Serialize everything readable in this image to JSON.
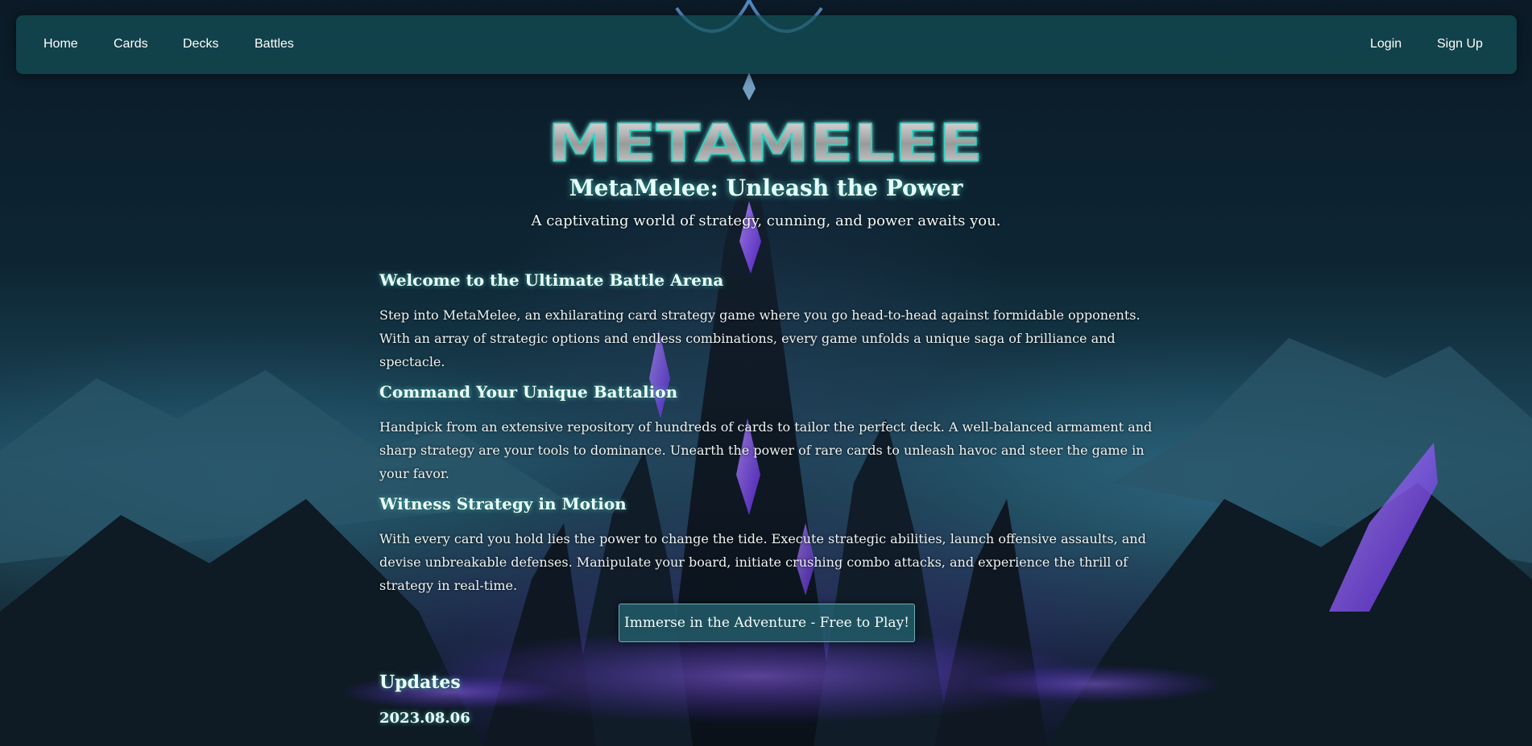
{
  "nav": {
    "left": [
      "Home",
      "Cards",
      "Decks",
      "Battles"
    ],
    "right": [
      "Login",
      "Sign Up"
    ]
  },
  "brand": {
    "logo_text": "METAMELEE",
    "title": "MetaMelee: Unleash the Power",
    "subtitle": "A captivating world of strategy, cunning, and power awaits you."
  },
  "sections": [
    {
      "title": "Welcome to the Ultimate Battle Arena",
      "text": "Step into MetaMelee, an exhilarating card strategy game where you go head-to-head against formidable opponents. With an array of strategic options and endless combinations, every game unfolds a unique saga of brilliance and spectacle."
    },
    {
      "title": "Command Your Unique Battalion",
      "text": "Handpick from an extensive repository of hundreds of cards to tailor the perfect deck. A well-balanced armament and sharp strategy are your tools to dominance. Unearth the power of rare cards to unleash havoc and steer the game in your favor."
    },
    {
      "title": "Witness Strategy in Motion",
      "text": "With every card you hold lies the power to change the tide. Execute strategic abilities, launch offensive assaults, and devise unbreakable defenses. Manipulate your board, initiate crushing combo attacks, and experience the thrill of strategy in real-time."
    }
  ],
  "cta": {
    "label": "Immerse in the Adventure - Free to Play!"
  },
  "updates": {
    "title": "Updates",
    "date": "2023.08.06"
  },
  "colors": {
    "navbar": "#145058",
    "heading_glow": "#5ae6dc",
    "crystal": "#7a3cff",
    "button": "#225c68"
  },
  "icons": {
    "logo": "metamelee-logo"
  }
}
